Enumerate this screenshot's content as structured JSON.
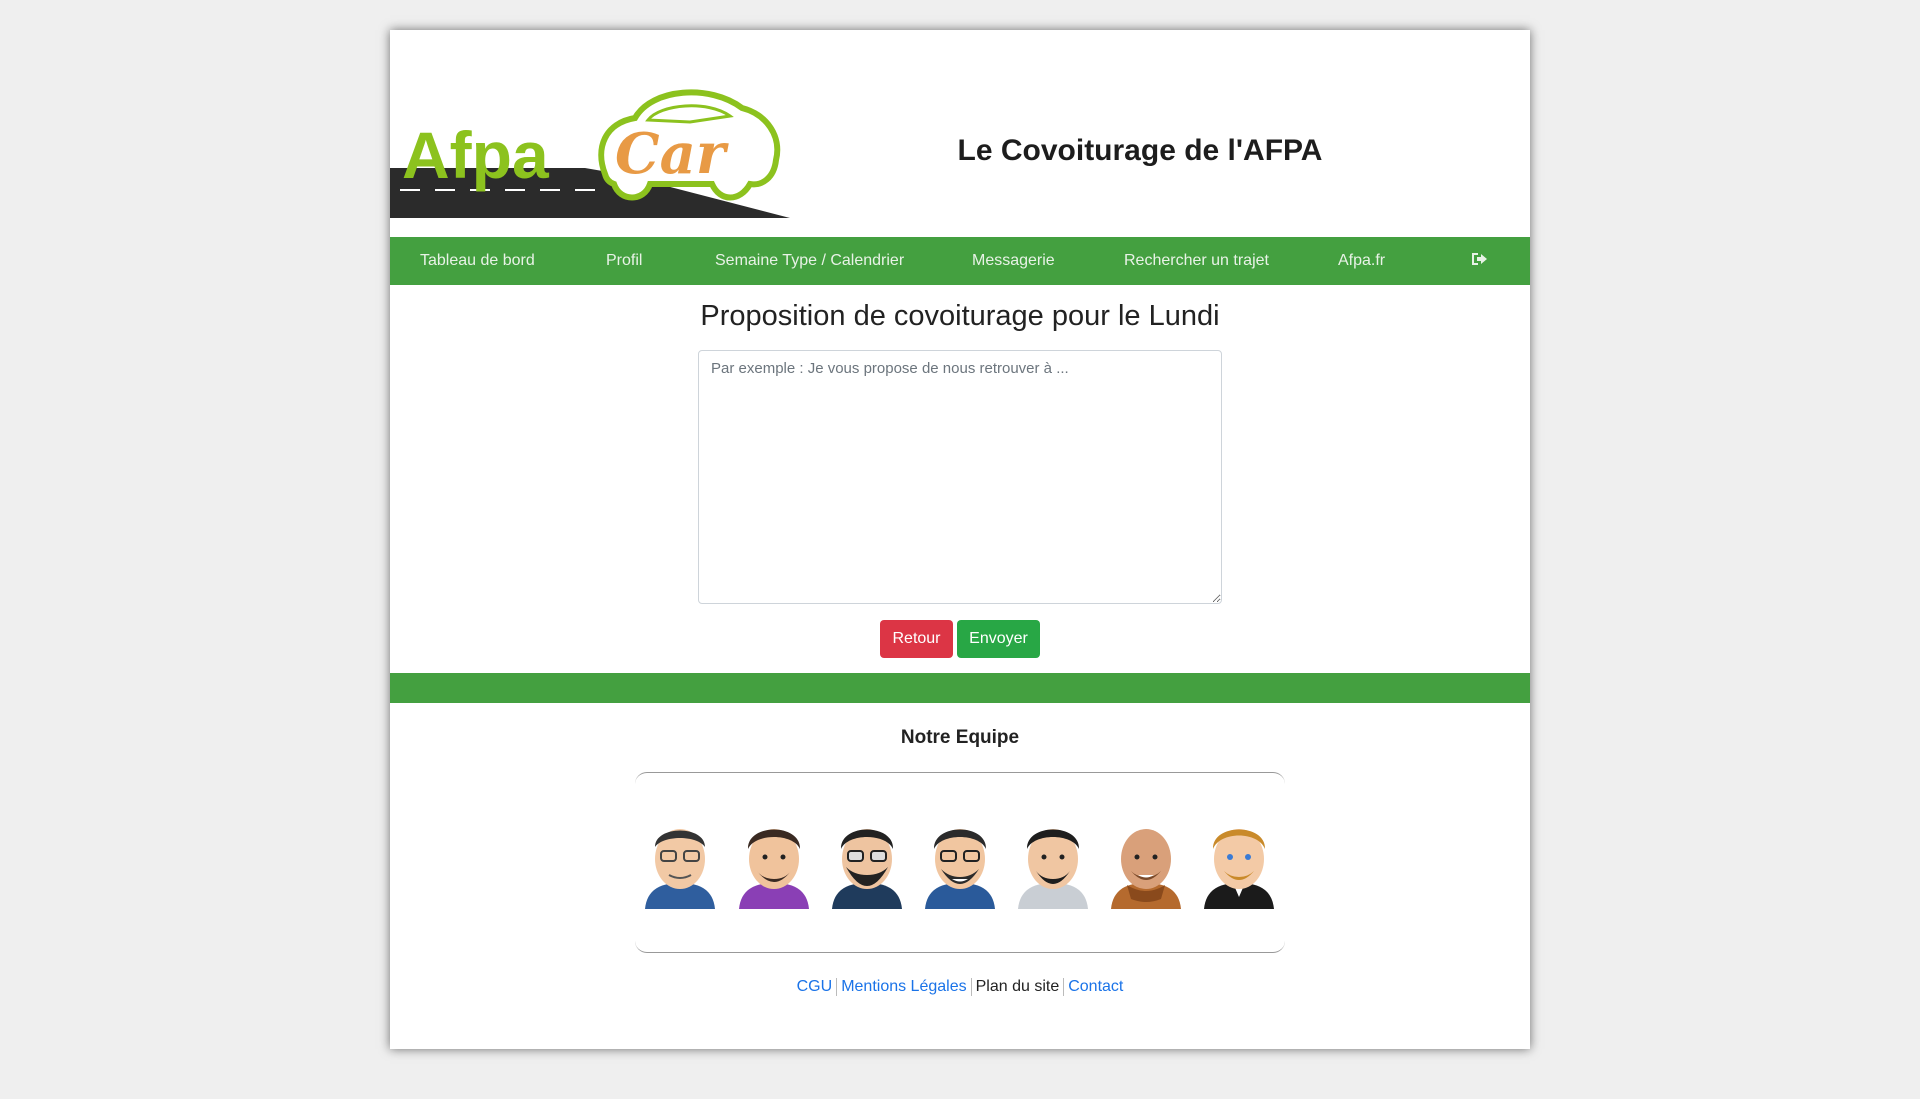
{
  "header": {
    "logo_text_1": "Afpa",
    "logo_text_2": "Car",
    "site_title": "Le Covoiturage de l'AFPA"
  },
  "nav": {
    "items": [
      {
        "label": "Tableau de bord"
      },
      {
        "label": "Profil"
      },
      {
        "label": "Semaine Type / Calendrier"
      },
      {
        "label": "Messagerie"
      },
      {
        "label": "Rechercher un trajet"
      },
      {
        "label": "Afpa.fr"
      }
    ],
    "logout_icon": "sign-out-icon"
  },
  "form": {
    "title": "Proposition de covoiturage pour le Lundi",
    "message_placeholder": "Par exemple : Je vous propose de nous retrouver à ...",
    "message_value": "",
    "retour_label": "Retour",
    "envoyer_label": "Envoyer"
  },
  "team": {
    "title": "Notre Equipe",
    "members": [
      {
        "icon": "avatar-glasses-blue-shirt"
      },
      {
        "icon": "avatar-beard-purple-shirt"
      },
      {
        "icon": "avatar-glasses-navy-hoodie"
      },
      {
        "icon": "avatar-glasses-blue-shirt-2"
      },
      {
        "icon": "avatar-beard-grey-shirt"
      },
      {
        "icon": "avatar-bald-scarf"
      },
      {
        "icon": "avatar-blond-suit"
      }
    ]
  },
  "footer": {
    "cgu": "CGU",
    "mentions": "Mentions Légales",
    "plan": "Plan du site",
    "contact": "Contact"
  },
  "colors": {
    "brand_green": "#44a040",
    "logo_green": "#8cc21e",
    "logo_orange": "#e89a45",
    "danger": "#dc3545",
    "success": "#28a745",
    "link": "#1a73e8"
  }
}
